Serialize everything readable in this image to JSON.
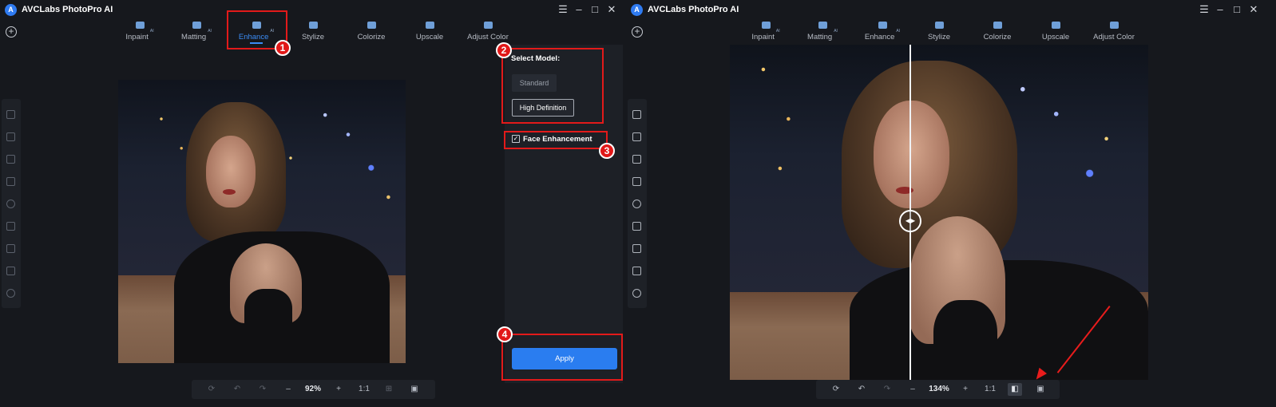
{
  "app": {
    "title": "AVCLabs PhotoPro AI",
    "logo_letter": "A"
  },
  "window_controls": {
    "menu": "☰",
    "minimize": "–",
    "maximize": "□",
    "close": "✕"
  },
  "tabs": [
    {
      "label": "Inpaint",
      "ai": "AI"
    },
    {
      "label": "Matting",
      "ai": "AI"
    },
    {
      "label": "Enhance",
      "ai": "AI"
    },
    {
      "label": "Stylize",
      "ai": ""
    },
    {
      "label": "Colorize",
      "ai": ""
    },
    {
      "label": "Upscale",
      "ai": ""
    },
    {
      "label": "Adjust Color",
      "ai": ""
    }
  ],
  "active_tab": "Enhance",
  "panel": {
    "select_model_label": "Select Model:",
    "model_options": [
      "Standard",
      "High Definition"
    ],
    "selected_model": "High Definition",
    "face_enhancement_label": "Face Enhancement",
    "face_enhancement_checked": true,
    "apply_label": "Apply"
  },
  "left_toolbar": {
    "zoom": "92%",
    "ratio": "1:1"
  },
  "right_toolbar": {
    "zoom": "134%",
    "ratio": "1:1"
  },
  "annotations": [
    "1",
    "2",
    "3",
    "4"
  ],
  "glyphs": {
    "plus": "+",
    "check": "✓",
    "undo": "↶",
    "redo": "↷",
    "rotate": "⟳",
    "minus": "–",
    "save": "▣",
    "compare": "◧",
    "crop": "⊞",
    "handle": "◀▶"
  },
  "colors": {
    "accent": "#2a7df0",
    "annotation_red": "#e21a1a",
    "background": "#16181d"
  }
}
